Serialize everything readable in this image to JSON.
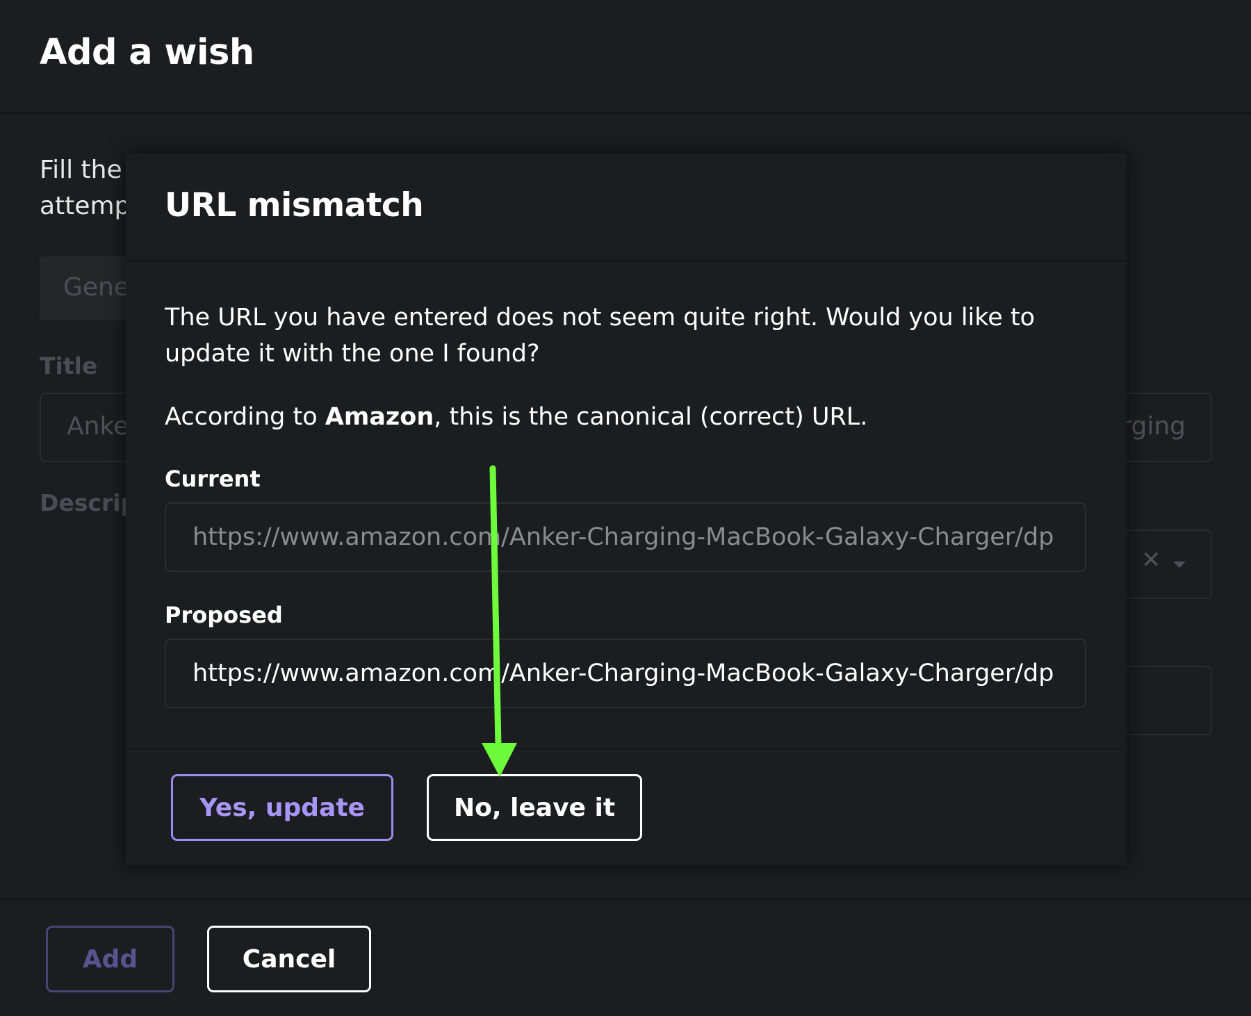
{
  "page": {
    "title": "Add a wish",
    "intro_line1": "Fill the",
    "intro_line2": "attemp",
    "tab_label": "Gene",
    "title_label": "Title",
    "title_value_start": "Anke",
    "title_value_end": "rging",
    "description_label": "Descrip",
    "clear_symbol": "✕",
    "add_button": "Add",
    "cancel_button": "Cancel"
  },
  "modal": {
    "title": "URL mismatch",
    "message_line1": "The URL you have entered does not seem quite right. Would you like to",
    "message_line2": "update it with the one I found?",
    "according_prefix": "According to ",
    "store_name": "Amazon",
    "according_suffix": ", this is the canonical (correct) URL.",
    "current_label": "Current",
    "current_url": "https://www.amazon.com/Anker-Charging-MacBook-Galaxy-Charger/dp",
    "proposed_label": "Proposed",
    "proposed_url": "https://www.amazon.com/Anker-Charging-MacBook-Galaxy-Charger/dp",
    "yes_button": "Yes, update",
    "no_button": "No, leave it"
  },
  "colors": {
    "background": "#1c1d20",
    "accent": "#9d8df1",
    "annotation_arrow": "#6efb3b"
  }
}
